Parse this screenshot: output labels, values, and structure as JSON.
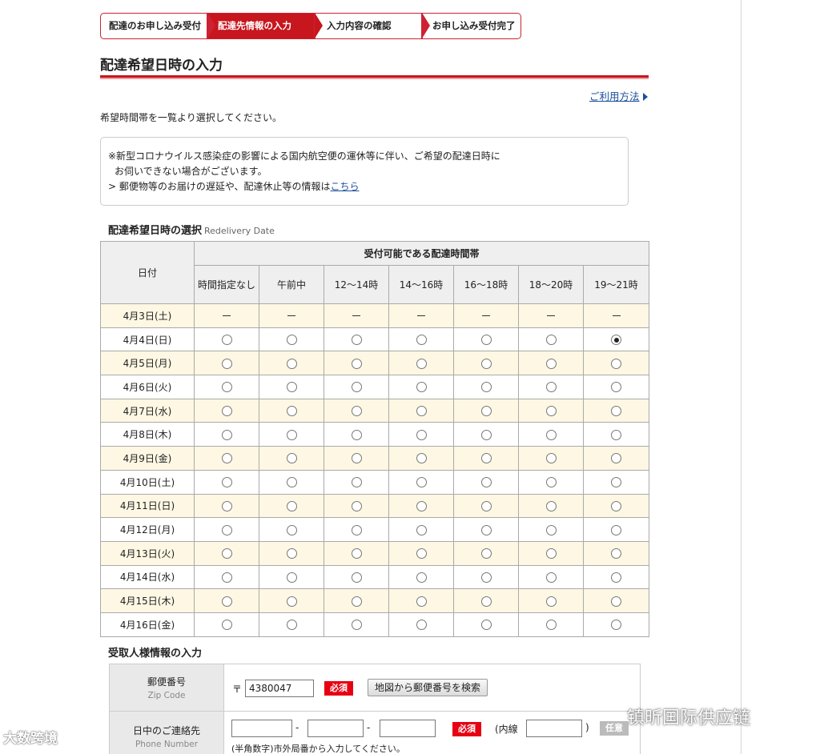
{
  "steps": [
    "配達のお申し込み受付",
    "配達先情報の入力",
    "入力内容の確認",
    "お申し込み受付完了"
  ],
  "page_title": "配達希望日時の入力",
  "help_link": "ご利用方法",
  "instruction": "希望時間帯を一覧より選択してください。",
  "notice": {
    "line1": "※新型コロナウイルス感染症の影響による国内航空便の運休等に伴い、ご希望の配達日時に",
    "line2": "お伺いできない場合がございます。",
    "line3": "> 郵便物等のお届けの遅延や、配達休止等の情報は",
    "link": "こちら"
  },
  "date_section": {
    "title": "配達希望日時の選択",
    "title_en": "Redelivery Date"
  },
  "table": {
    "date_header": "日付",
    "group_header": "受付可能である配達時間帯",
    "slots": [
      "時間指定なし",
      "午前中",
      "12〜14時",
      "14〜16時",
      "16〜18時",
      "18〜20時",
      "19〜21時"
    ],
    "rows": [
      {
        "date": "4月3日(土)",
        "available": false,
        "selected": null
      },
      {
        "date": "4月4日(日)",
        "available": true,
        "selected": 6
      },
      {
        "date": "4月5日(月)",
        "available": true,
        "selected": null
      },
      {
        "date": "4月6日(火)",
        "available": true,
        "selected": null
      },
      {
        "date": "4月7日(水)",
        "available": true,
        "selected": null
      },
      {
        "date": "4月8日(木)",
        "available": true,
        "selected": null
      },
      {
        "date": "4月9日(金)",
        "available": true,
        "selected": null
      },
      {
        "date": "4月10日(土)",
        "available": true,
        "selected": null
      },
      {
        "date": "4月11日(日)",
        "available": true,
        "selected": null
      },
      {
        "date": "4月12日(月)",
        "available": true,
        "selected": null
      },
      {
        "date": "4月13日(火)",
        "available": true,
        "selected": null
      },
      {
        "date": "4月14日(水)",
        "available": true,
        "selected": null
      },
      {
        "date": "4月15日(木)",
        "available": true,
        "selected": null
      },
      {
        "date": "4月16日(金)",
        "available": true,
        "selected": null
      }
    ]
  },
  "recipient_section": {
    "title": "受取人様情報の入力"
  },
  "zip": {
    "label": "郵便番号",
    "label_en": "Zip Code",
    "mark": "〒",
    "value": "4380047",
    "required": "必須",
    "search_button": "地図から郵便番号を検索"
  },
  "phone": {
    "label": "日中のご連絡先",
    "label_en": "Phone Number",
    "sep": "-",
    "required": "必須",
    "ext_open": "(内線",
    "ext_close": ")",
    "optional": "任意",
    "note": "(半角数字)市外局番から入力してください。"
  },
  "watermark_left": "大数跨境",
  "watermark_right": "镇昕国际供应链"
}
